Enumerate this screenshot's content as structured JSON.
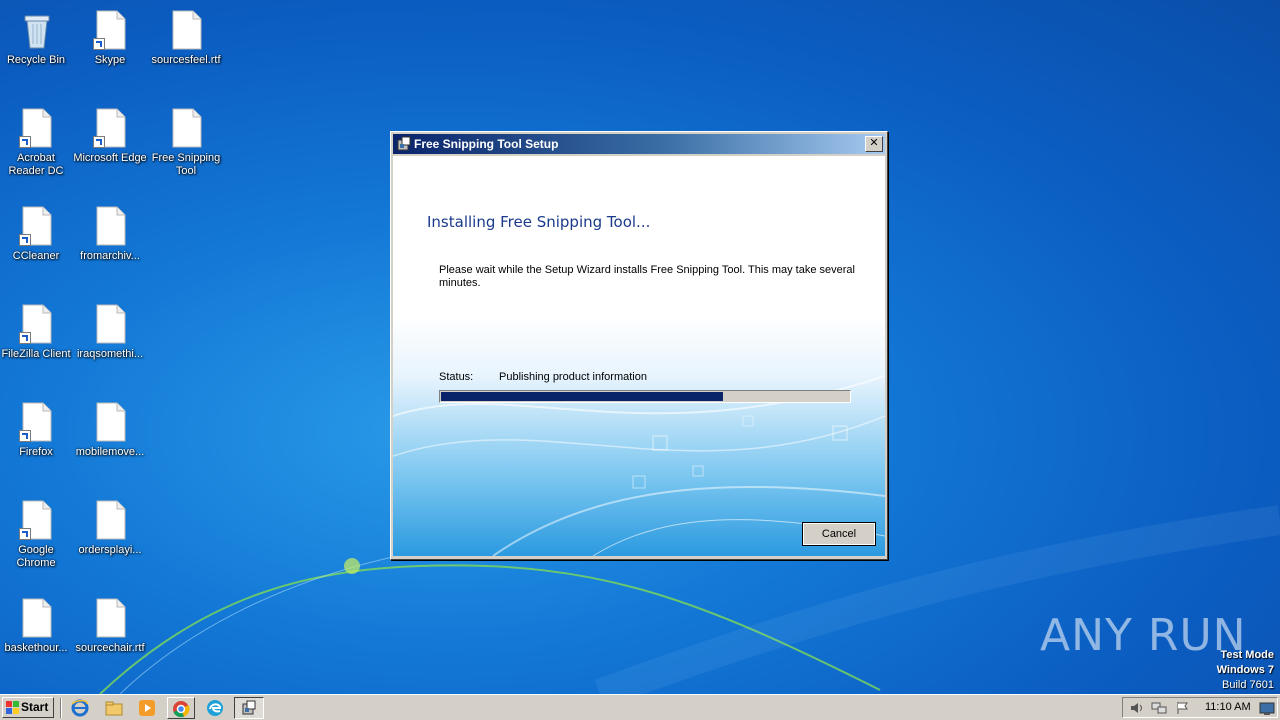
{
  "desktop_icons": [
    {
      "label": "Recycle Bin",
      "icon": "recycle-bin-icon",
      "shortcut": false
    },
    {
      "label": "Skype",
      "icon": "file-icon",
      "shortcut": true
    },
    {
      "label": "sourcesfeel.rtf",
      "icon": "file-icon",
      "shortcut": false
    },
    {
      "label": "Acrobat Reader DC",
      "icon": "file-icon",
      "shortcut": true
    },
    {
      "label": "Microsoft Edge",
      "icon": "file-icon",
      "shortcut": true
    },
    {
      "label": "Free Snipping Tool",
      "icon": "file-icon",
      "shortcut": false
    },
    {
      "label": "CCleaner",
      "icon": "file-icon",
      "shortcut": true
    },
    {
      "label": "fromarchiv...",
      "icon": "file-icon",
      "shortcut": false
    },
    {
      "label": "FileZilla Client",
      "icon": "file-icon",
      "shortcut": true
    },
    {
      "label": "iraqsomethi...",
      "icon": "file-icon",
      "shortcut": false
    },
    {
      "label": "Firefox",
      "icon": "file-icon",
      "shortcut": true
    },
    {
      "label": "mobilemove...",
      "icon": "file-icon",
      "shortcut": false
    },
    {
      "label": "Google Chrome",
      "icon": "file-icon",
      "shortcut": true
    },
    {
      "label": "ordersplayi...",
      "icon": "file-icon",
      "shortcut": false
    },
    {
      "label": "baskethour...",
      "icon": "file-icon",
      "shortcut": false
    },
    {
      "label": "sourcechair.rtf",
      "icon": "file-icon",
      "shortcut": false
    }
  ],
  "dialog": {
    "title": "Free Snipping Tool Setup",
    "close_label": "✕",
    "heading": "Installing Free Snipping Tool...",
    "description": "Please wait while the Setup Wizard installs Free Snipping Tool.  This may take several minutes.",
    "status_label": "Status:",
    "status_value": "Publishing product information",
    "progress_fraction": 0.69,
    "cancel_label": "Cancel"
  },
  "watermark": "ANY RUN",
  "system_info": {
    "line1": "Test Mode",
    "line2": "Windows 7",
    "line3": "Build 7601"
  },
  "taskbar": {
    "start_label": "Start",
    "pinned": [
      "ie-icon",
      "explorer-icon",
      "media-player-icon",
      "chrome-icon",
      "edge-icon",
      "setup-icon"
    ],
    "clock": "11:10 AM"
  },
  "colors": {
    "titlebar_start": "#0a246a",
    "titlebar_end": "#a6caf0",
    "progress_fill": "#0a246a",
    "heading_text": "#1a3a8a"
  }
}
